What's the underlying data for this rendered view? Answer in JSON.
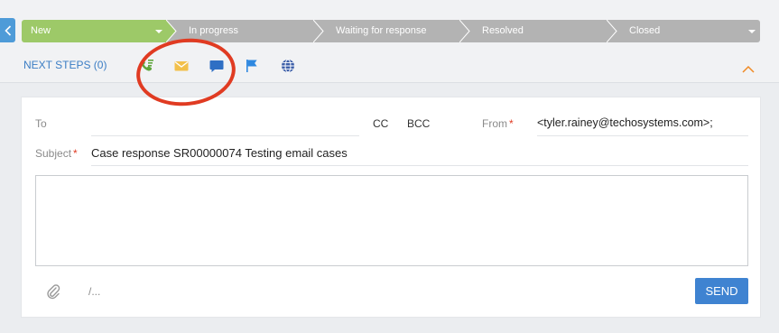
{
  "stages": [
    {
      "label": "New",
      "active": true
    },
    {
      "label": "In progress",
      "active": false
    },
    {
      "label": "Waiting for response",
      "active": false
    },
    {
      "label": "Resolved",
      "active": false
    },
    {
      "label": "Closed",
      "active": false
    }
  ],
  "next_steps": {
    "label": "NEXT STEPS (0)",
    "icons": [
      "phone-call-icon",
      "email-icon",
      "message-icon",
      "flag-icon",
      "globe-icon"
    ],
    "selected": "email-icon"
  },
  "email": {
    "to_label": "To",
    "to_value": "",
    "cc_label": "CC",
    "bcc_label": "BCC",
    "from_label": "From",
    "from_value": "<tyler.rainey@techosystems.com>;",
    "subject_label": "Subject",
    "subject_value": "Case response SR00000074 Testing email cases",
    "body_value": "",
    "signature_label": "/...",
    "send_label": "SEND"
  },
  "colors": {
    "active_stage": "#9dc968",
    "inactive_stage": "#b3b3b3",
    "accent_blue": "#3f83d1",
    "required": "#e03b22",
    "highlight_circle": "#e03b22"
  }
}
